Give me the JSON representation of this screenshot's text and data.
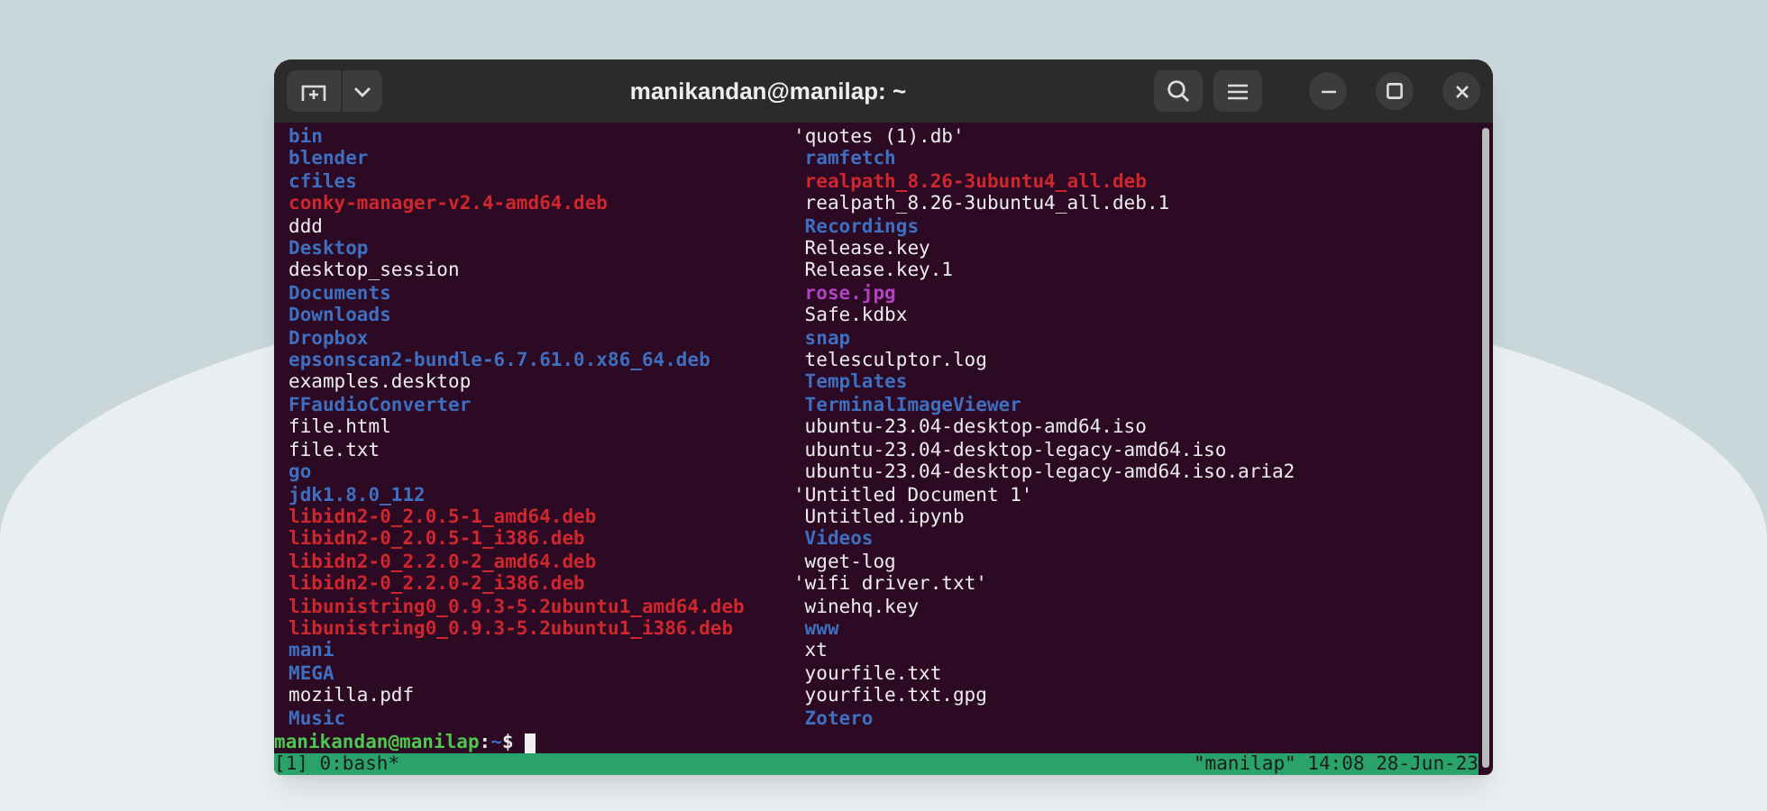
{
  "window": {
    "title": "manikandan@manilap: ~"
  },
  "listing": {
    "columns": [
      [
        {
          "name": "bin",
          "kind": "dir"
        },
        {
          "name": "blender",
          "kind": "dir"
        },
        {
          "name": "cfiles",
          "kind": "dir"
        },
        {
          "name": "conky-manager-v2.4-amd64.deb",
          "kind": "deb"
        },
        {
          "name": "ddd",
          "kind": "file"
        },
        {
          "name": "Desktop",
          "kind": "dir"
        },
        {
          "name": "desktop_session",
          "kind": "file"
        },
        {
          "name": "Documents",
          "kind": "dir"
        },
        {
          "name": "Downloads",
          "kind": "dir"
        },
        {
          "name": "Dropbox",
          "kind": "dir"
        },
        {
          "name": "epsonscan2-bundle-6.7.61.0.x86_64.deb",
          "kind": "dir"
        },
        {
          "name": "examples.desktop",
          "kind": "file"
        },
        {
          "name": "FFaudioConverter",
          "kind": "dir"
        },
        {
          "name": "file.html",
          "kind": "file"
        },
        {
          "name": "file.txt",
          "kind": "file"
        },
        {
          "name": "go",
          "kind": "dir"
        },
        {
          "name": "jdk1.8.0_112",
          "kind": "dir"
        },
        {
          "name": "libidn2-0_2.0.5-1_amd64.deb",
          "kind": "deb"
        },
        {
          "name": "libidn2-0_2.0.5-1_i386.deb",
          "kind": "deb"
        },
        {
          "name": "libidn2-0_2.2.0-2_amd64.deb",
          "kind": "deb"
        },
        {
          "name": "libidn2-0_2.2.0-2_i386.deb",
          "kind": "deb"
        },
        {
          "name": "libunistring0_0.9.3-5.2ubuntu1_amd64.deb",
          "kind": "deb"
        },
        {
          "name": "libunistring0_0.9.3-5.2ubuntu1_i386.deb",
          "kind": "deb"
        },
        {
          "name": "mani",
          "kind": "dir"
        },
        {
          "name": "MEGA",
          "kind": "dir"
        },
        {
          "name": "mozilla.pdf",
          "kind": "file"
        },
        {
          "name": "Music",
          "kind": "dir"
        }
      ],
      [
        {
          "name": "'quotes (1).db'",
          "kind": "file",
          "padded": false
        },
        {
          "name": "ramfetch",
          "kind": "dir",
          "padded": true
        },
        {
          "name": "realpath_8.26-3ubuntu4_all.deb",
          "kind": "deb",
          "padded": true
        },
        {
          "name": "realpath_8.26-3ubuntu4_all.deb.1",
          "kind": "file",
          "padded": true
        },
        {
          "name": "Recordings",
          "kind": "dir",
          "padded": true
        },
        {
          "name": "Release.key",
          "kind": "file",
          "padded": true
        },
        {
          "name": "Release.key.1",
          "kind": "file",
          "padded": true
        },
        {
          "name": "rose.jpg",
          "kind": "image",
          "padded": true
        },
        {
          "name": "Safe.kdbx",
          "kind": "file",
          "padded": true
        },
        {
          "name": "snap",
          "kind": "dir",
          "padded": true
        },
        {
          "name": "telesculptor.log",
          "kind": "file",
          "padded": true
        },
        {
          "name": "Templates",
          "kind": "dir",
          "padded": true
        },
        {
          "name": "TerminalImageViewer",
          "kind": "dir",
          "padded": true
        },
        {
          "name": "ubuntu-23.04-desktop-amd64.iso",
          "kind": "file",
          "padded": true
        },
        {
          "name": "ubuntu-23.04-desktop-legacy-amd64.iso",
          "kind": "file",
          "padded": true
        },
        {
          "name": "ubuntu-23.04-desktop-legacy-amd64.iso.aria2",
          "kind": "file",
          "padded": true
        },
        {
          "name": "'Untitled Document 1'",
          "kind": "file",
          "padded": false
        },
        {
          "name": "Untitled.ipynb",
          "kind": "file",
          "padded": true
        },
        {
          "name": "Videos",
          "kind": "dir",
          "padded": true
        },
        {
          "name": "wget-log",
          "kind": "file",
          "padded": true
        },
        {
          "name": "'wifi driver.txt'",
          "kind": "file",
          "padded": false
        },
        {
          "name": "winehq.key",
          "kind": "file",
          "padded": true
        },
        {
          "name": "www",
          "kind": "dir",
          "padded": true
        },
        {
          "name": "xt",
          "kind": "file",
          "padded": true
        },
        {
          "name": "yourfile.txt",
          "kind": "file",
          "padded": true
        },
        {
          "name": "yourfile.txt.gpg",
          "kind": "file",
          "padded": true
        },
        {
          "name": "Zotero",
          "kind": "dir",
          "padded": true
        }
      ]
    ]
  },
  "prompt": {
    "user_host": "manikandan@manilap",
    "separator": ":",
    "path": "~",
    "symbol": "$"
  },
  "status_bar": {
    "left": "[1] 0:bash*",
    "right": "\"manilap\" 14:08 28-Jun-23"
  }
}
